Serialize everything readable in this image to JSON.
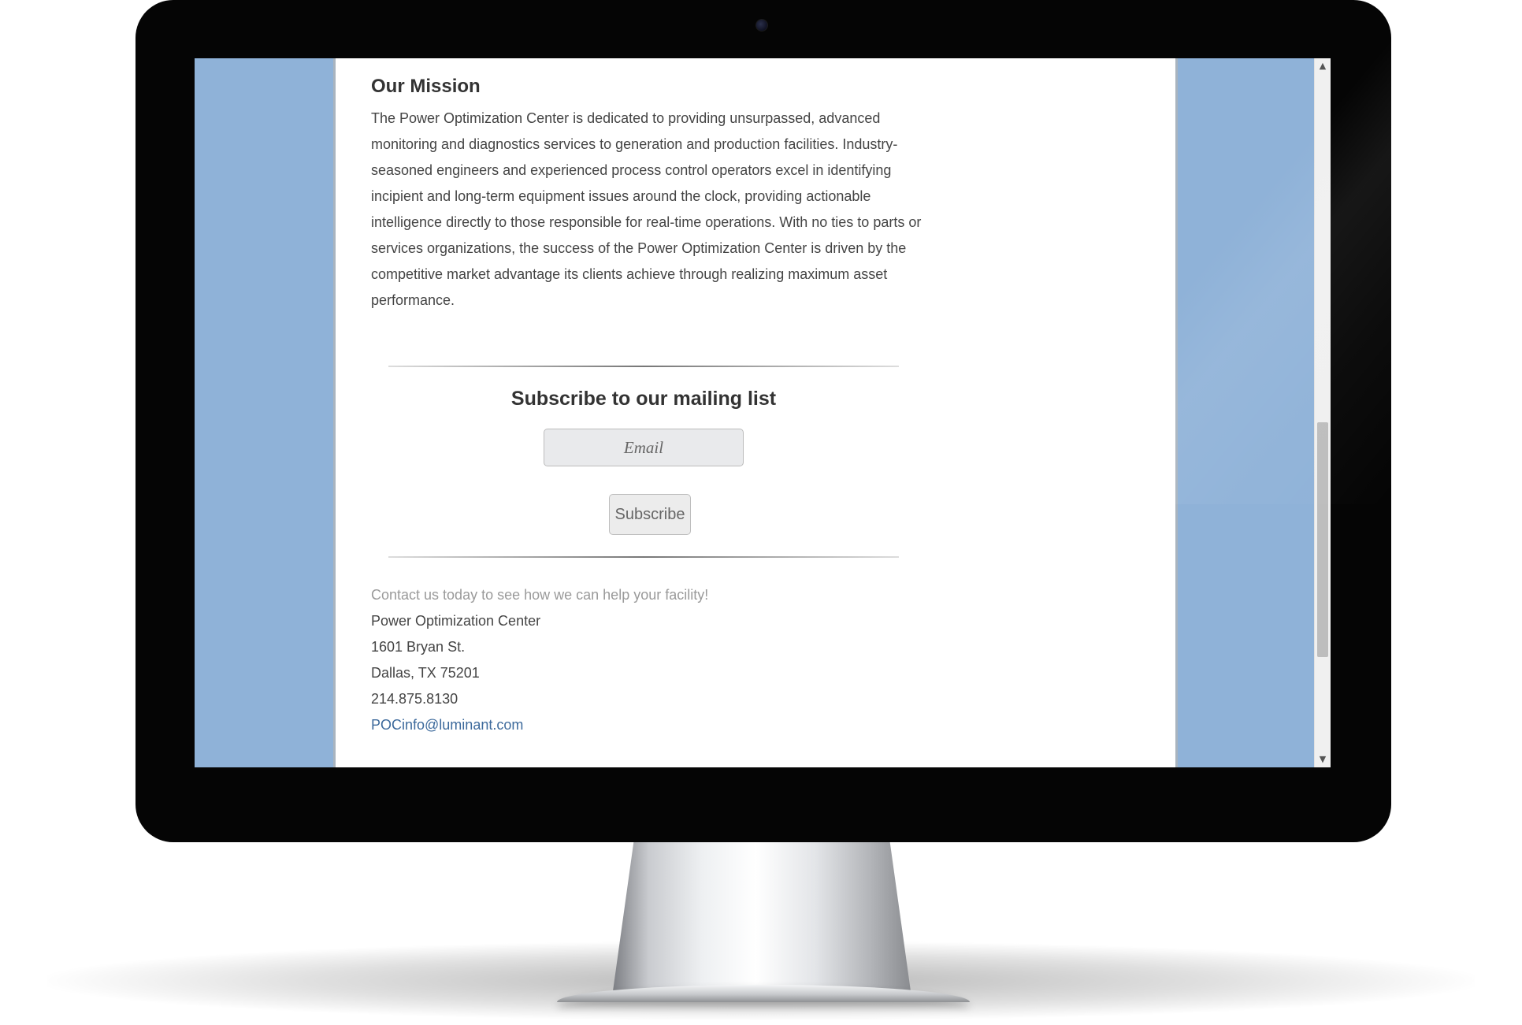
{
  "page": {
    "mission": {
      "heading": "Our Mission",
      "text": "The Power Optimization Center is dedicated to providing unsurpassed, advanced monitoring and diagnostics services to generation and production facilities. Industry-seasoned engineers and experienced process control operators excel in identifying incipient and long-term equipment issues around the clock, providing actionable intelligence directly to those responsible for real-time operations. With no ties to parts or services organizations, the success of the Power Optimization Center is driven by the competitive market advantage its clients achieve through realizing maximum asset performance."
    },
    "subscribe": {
      "heading": "Subscribe to our mailing list",
      "email_placeholder": "Email",
      "button_label": "Subscribe"
    },
    "contact": {
      "cta": "Contact us today to see how we can help your facility!",
      "org": "Power Optimization Center",
      "street": "1601 Bryan St.",
      "city": "Dallas, TX 75201",
      "phone": "214.875.8130",
      "email": "POCinfo@luminant.com"
    }
  },
  "scrollbar": {
    "up_icon": "chevron-up-icon",
    "down_icon": "chevron-down-icon",
    "position_fraction": 0.62
  },
  "colors": {
    "side_background": "#8fb2d8",
    "link": "#3d6a9c",
    "bezel": "#050505"
  }
}
